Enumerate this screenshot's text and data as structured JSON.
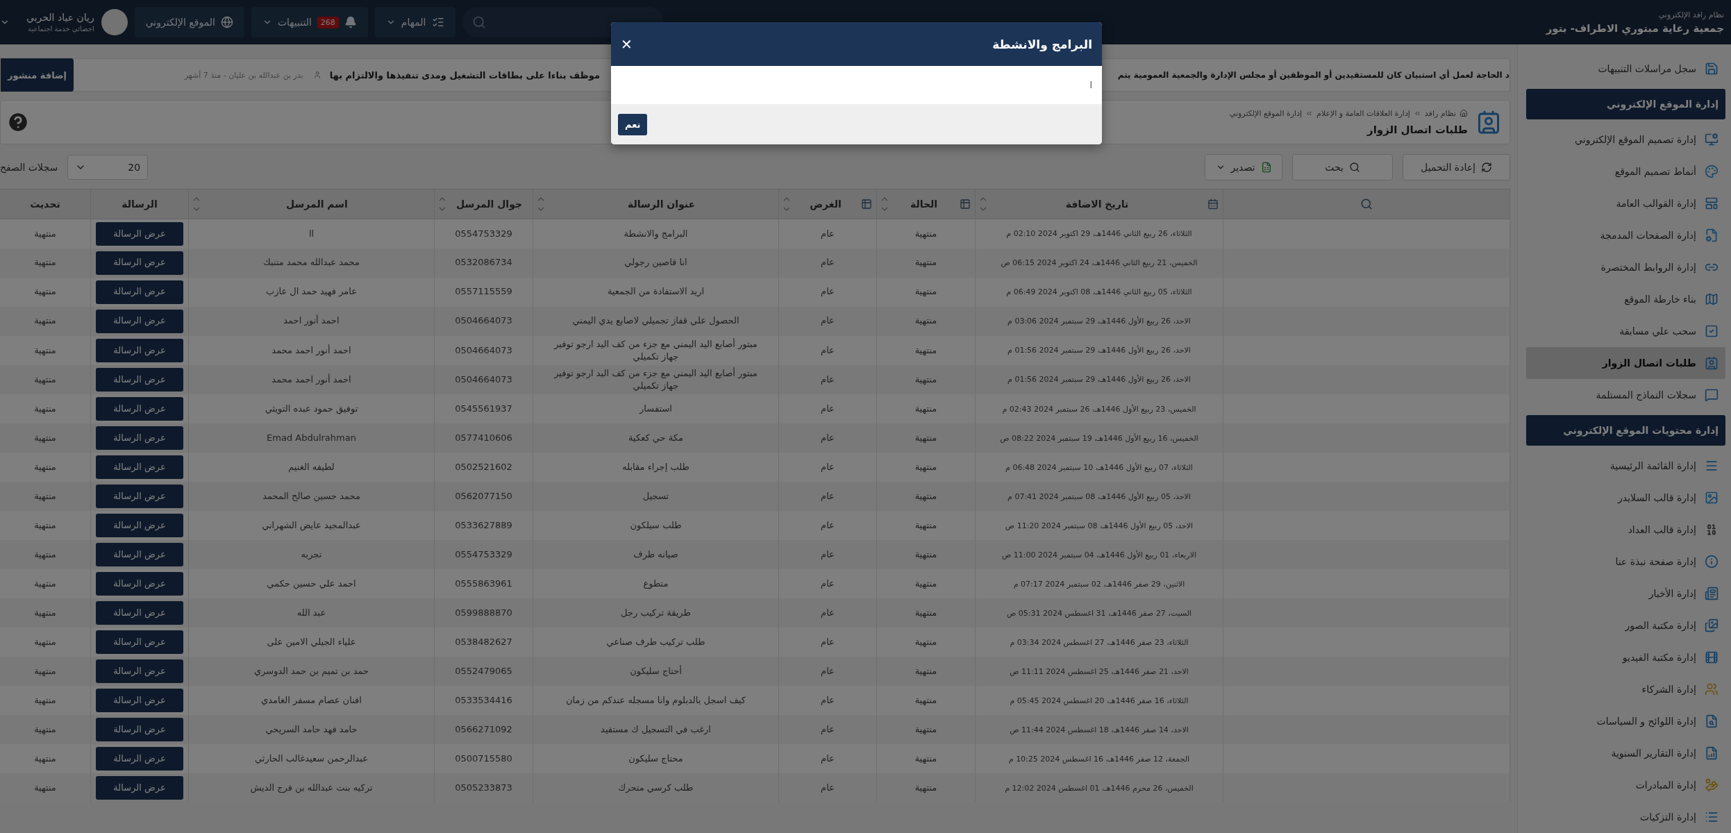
{
  "header": {
    "system_name": "نظام رافد الإلكتروني",
    "org_name": "جمعية رعاية مبتوري الاطراف- بتور",
    "tasks": "المهام",
    "notifications": {
      "label": "التنبيهات",
      "count": "268"
    },
    "website": "الموقع الإلكتروني",
    "user": {
      "name": "ريان عياد الحربي",
      "role": "اخصائي خدمة اجتماعية"
    }
  },
  "ticker": {
    "parts": [
      "د الحاجة لعمل أي استبيان كان للمستفيدين أو الموظفين أو مجلس الإدارة والجمعية العمومية يتم",
      "موظف بناءا على بطاقات التشغيل ومدى تنفيذها والالتزام بها"
    ],
    "author": "بدر بن عبدالله بن عليان - منذ 7 أشهر",
    "add_post": "إضافة منشور"
  },
  "page": {
    "breadcrumb": [
      "نظام رافد",
      "إدارة العلاقات العامة و الإعلام",
      "إدارة الموقع الإلكتروني"
    ],
    "title": "طلبات اتصال الزوار"
  },
  "toolbar": {
    "buttons": [
      {
        "kind": "reload",
        "label": "إعادة التحميل"
      },
      {
        "kind": "search",
        "label": "بحث"
      },
      {
        "kind": "export",
        "label": "تصدير"
      }
    ],
    "page_size": "20",
    "page_size_label": "سجلات الصفح"
  },
  "table": {
    "columns": [
      {
        "kind": "search",
        "sortable": false
      },
      {
        "kind": "date",
        "label": "تاريخ الاضافة",
        "sortable": true
      },
      {
        "kind": "list",
        "label": "الحالة",
        "sortable": true
      },
      {
        "kind": "list",
        "label": "الغرض",
        "sortable": true
      },
      {
        "kind": "plain",
        "label": "عنوان الرسالة",
        "sortable": true
      },
      {
        "kind": "plain",
        "label": "جوال المرسل",
        "sortable": true
      },
      {
        "kind": "plain",
        "label": "اسم المرسل",
        "sortable": true
      },
      {
        "kind": "plain",
        "label": "الرسالة",
        "sortable": false
      },
      {
        "kind": "plain",
        "label": "تحديث",
        "sortable": false
      }
    ],
    "rows": [
      {
        "date": "الثلاثاء، 26 ربيع الثاني 1446هـ، 29 اكتوبر 2024 02:10 م",
        "status": "منتهية",
        "purpose": "عام",
        "subject": "البرامج والانشطة",
        "mobile": "0554753329",
        "sender": "ll",
        "action": "عرض الرسالة",
        "update": "منتهية"
      },
      {
        "date": "الخميس، 21 ربيع الثاني 1446هـ، 24 اكتوبر 2024 06:15 ص",
        "status": "منتهية",
        "purpose": "عام",
        "subject": "انا قاصين رجولي",
        "mobile": "0532086734",
        "sender": "محمد عبدالله محمد متنبك",
        "action": "عرض الرسالة",
        "update": "منتهية"
      },
      {
        "date": "الثلاثاء، 05 ربيع الثاني 1446هـ، 08 اكتوبر 2024 06:49 م",
        "status": "منتهية",
        "purpose": "عام",
        "subject": "اريد الاستفادة من الجمعية",
        "mobile": "0557115559",
        "sender": "عامر فهيد حمد ال عازب",
        "action": "عرض الرسالة",
        "update": "منتهية"
      },
      {
        "date": "الاحد، 26 ربيع الأول 1446هـ، 29 سبتمبر 2024 03:06 م",
        "status": "منتهية",
        "purpose": "عام",
        "subject": "الحصول علي قفاز تجميلي لاصابع يدي اليمني",
        "mobile": "0504664073",
        "sender": "احمد أنور احمد",
        "action": "عرض الرسالة",
        "update": "منتهية"
      },
      {
        "date": "الاحد، 26 ربيع الأول 1446هـ، 29 سبتمبر 2024 01:56 م",
        "status": "منتهية",
        "purpose": "عام",
        "subject": "مبتور أصابع اليد اليمني مع جزء من كف اليد ارجو توفير جهاز تكميلي",
        "mobile": "0504664073",
        "sender": "احمد أنور احمد محمد",
        "action": "عرض الرسالة",
        "update": "منتهية"
      },
      {
        "date": "الاحد، 26 ربيع الأول 1446هـ، 29 سبتمبر 2024 01:56 م",
        "status": "منتهية",
        "purpose": "عام",
        "subject": "مبتور أصابع اليد اليمني مع جزء من كف اليد ارجو توفير جهاز تكميلي",
        "mobile": "0504664073",
        "sender": "احمد أنور احمد محمد",
        "action": "عرض الرسالة",
        "update": "منتهية"
      },
      {
        "date": "الخميس، 23 ربيع الأول 1446هـ، 26 سبتمبر 2024 02:43 م",
        "status": "منتهية",
        "purpose": "عام",
        "subject": "استفسار",
        "mobile": "0545561937",
        "sender": "توفيق حمود عبده التويثي",
        "action": "عرض الرسالة",
        "update": "منتهية"
      },
      {
        "date": "الخميس، 16 ربيع الأول 1446هـ، 19 سبتمبر 2024 08:22 ص",
        "status": "منتهية",
        "purpose": "عام",
        "subject": "مكة حي كعكية",
        "mobile": "0577410606",
        "sender": "Emad Abdulrahman",
        "action": "عرض الرسالة",
        "update": "منتهية"
      },
      {
        "date": "الثلاثاء، 07 ربيع الأول 1446هـ، 10 سبتمبر 2024 06:48 م",
        "status": "منتهية",
        "purpose": "عام",
        "subject": "طلب إجراء مقابله",
        "mobile": "0502521602",
        "sender": "لطيفه الغنيم",
        "action": "عرض الرسالة",
        "update": "منتهية"
      },
      {
        "date": "الاحد، 05 ربيع الأول 1446هـ، 08 سبتمبر 2024 07:41 م",
        "status": "منتهية",
        "purpose": "عام",
        "subject": "تسجيل",
        "mobile": "0562077150",
        "sender": "محمد حسين صالح المحمد",
        "action": "عرض الرسالة",
        "update": "منتهية"
      },
      {
        "date": "الاحد، 05 ربيع الأول 1446هـ، 08 سبتمبر 2024 11:20 ص",
        "status": "منتهية",
        "purpose": "عام",
        "subject": "طلب سيلكون",
        "mobile": "0533627889",
        "sender": "عبدالمجيد عايض الشهراني",
        "action": "عرض الرسالة",
        "update": "منتهية"
      },
      {
        "date": "الاربعاء، 01 ربيع الأول 1446هـ، 04 سبتمبر 2024 11:00 ص",
        "status": "منتهية",
        "purpose": "عام",
        "subject": "صيانه طرف",
        "mobile": "0554753329",
        "sender": "تجربه",
        "action": "عرض الرسالة",
        "update": "منتهية"
      },
      {
        "date": "الاثنين، 29 صفر 1446هـ، 02 سبتمبر 2024 07:17 م",
        "status": "منتهية",
        "purpose": "عام",
        "subject": "متطوع",
        "mobile": "0555863961",
        "sender": "احمد علي حسين حكمي",
        "action": "عرض الرسالة",
        "update": "منتهية"
      },
      {
        "date": "السبت، 27 صفر 1446هـ، 31 اغسطس 2024 05:31 ص",
        "status": "منتهية",
        "purpose": "عام",
        "subject": "طريقة تركيب رجل",
        "mobile": "0599888870",
        "sender": "عبد الله",
        "action": "عرض الرسالة",
        "update": "منتهية"
      },
      {
        "date": "الثلاثاء، 23 صفر 1446هـ، 27 اغسطس 2024 03:34 م",
        "status": "منتهية",
        "purpose": "عام",
        "subject": "طلب تركيب طرف صناعي",
        "mobile": "0538482627",
        "sender": "علياء الجيلي الامين على",
        "action": "عرض الرسالة",
        "update": "منتهية"
      },
      {
        "date": "الاحد، 21 صفر 1446هـ، 25 اغسطس 2024 11:11 ص",
        "status": "منتهية",
        "purpose": "عام",
        "subject": "أحتاج سليكون",
        "mobile": "0552479065",
        "sender": "حمد بن تميم بن حمد الدوسري",
        "action": "عرض الرسالة",
        "update": "منتهية"
      },
      {
        "date": "الثلاثاء، 16 صفر 1446هـ، 20 اغسطس 2024 05:45 م",
        "status": "منتهية",
        "purpose": "عام",
        "subject": "كيف اسجل بالدبلوم وانا مسجله عندكم من زمان",
        "mobile": "0533534416",
        "sender": "افنان عصام مسفر الغامدي",
        "action": "عرض الرسالة",
        "update": "منتهية"
      },
      {
        "date": "الاحد، 14 صفر 1446هـ، 18 اغسطس 2024 11:44 ص",
        "status": "منتهية",
        "purpose": "عام",
        "subject": "ارغب في التسجيل ك مستفيد",
        "mobile": "0566271092",
        "sender": "حامد فهد حامد السريحي",
        "action": "عرض الرسالة",
        "update": "منتهية"
      },
      {
        "date": "الجمعة، 12 صفر 1446هـ، 16 اغسطس 2024 10:25 م",
        "status": "منتهية",
        "purpose": "عام",
        "subject": "محتاج سليكون",
        "mobile": "0500715580",
        "sender": "عبدالرحمن سعيدغالب الحارثي",
        "action": "عرض الرسالة",
        "update": "منتهية"
      },
      {
        "date": "الخميس، 26 محرم 1446هـ، 01 اغسطس 2024 12:02 م",
        "status": "منتهية",
        "purpose": "عام",
        "subject": "طلب كرسي متحرك",
        "mobile": "0505233873",
        "sender": "تركيه بنت عبدالله بن فرج الديش",
        "action": "عرض الرسالة",
        "update": "منتهية"
      }
    ]
  },
  "sidebar": {
    "items": [
      {
        "kind": "link",
        "label": "سجل مراسلات التنبيهات",
        "selected": false
      },
      {
        "kind": "section",
        "label": "إدارة الموقع الإلكتروني"
      },
      {
        "kind": "link",
        "label": "إدارة تصميم الموقع الإلكتروني",
        "selected": false
      },
      {
        "kind": "link",
        "label": "أنماط تصميم الموقع",
        "selected": false
      },
      {
        "kind": "link",
        "label": "إدارة القوالب العامة",
        "selected": false
      },
      {
        "kind": "link",
        "label": "إدارة الصفحات المدمجة",
        "selected": false
      },
      {
        "kind": "link",
        "label": "إدارة الروابط المختصرة",
        "selected": false
      },
      {
        "kind": "link",
        "label": "بناء خارطة الموقع",
        "selected": false
      },
      {
        "kind": "link",
        "label": "سحب علي مسابقة",
        "selected": false
      },
      {
        "kind": "link",
        "label": "طلبات اتصال الزوار",
        "selected": true
      },
      {
        "kind": "link",
        "label": "سجلات النماذج المستلمة",
        "selected": false
      },
      {
        "kind": "section",
        "label": "إدارة محتويات الموقع الإلكتروني"
      },
      {
        "kind": "link",
        "label": "إدارة القائمة الرئيسية",
        "selected": false
      },
      {
        "kind": "link",
        "label": "إدارة قالب السلايدر",
        "selected": false
      },
      {
        "kind": "link",
        "label": "إدارة قالب العداد",
        "selected": false
      },
      {
        "kind": "link",
        "label": "إدارة صفحة نبذة عنا",
        "selected": false
      },
      {
        "kind": "link",
        "label": "إدارة الأخبار",
        "selected": false
      },
      {
        "kind": "link",
        "label": "إدارة مكتبة الصور",
        "selected": false
      },
      {
        "kind": "link",
        "label": "إدارة مكتبة الفيديو",
        "selected": false
      },
      {
        "kind": "link",
        "label": "إدارة الشركاء",
        "selected": false
      },
      {
        "kind": "link",
        "label": "إدارة اللوائح و السياسات",
        "selected": false
      },
      {
        "kind": "link",
        "label": "إدارة التقارير السنوية",
        "selected": false
      },
      {
        "kind": "link",
        "label": "إدارة المبادرات",
        "selected": false
      },
      {
        "kind": "link",
        "label": "إدارة التزكيات",
        "selected": false
      }
    ]
  },
  "modal": {
    "title": "البرامج والانشطة",
    "close": "✕",
    "body": "ا",
    "confirm": "نعم"
  }
}
